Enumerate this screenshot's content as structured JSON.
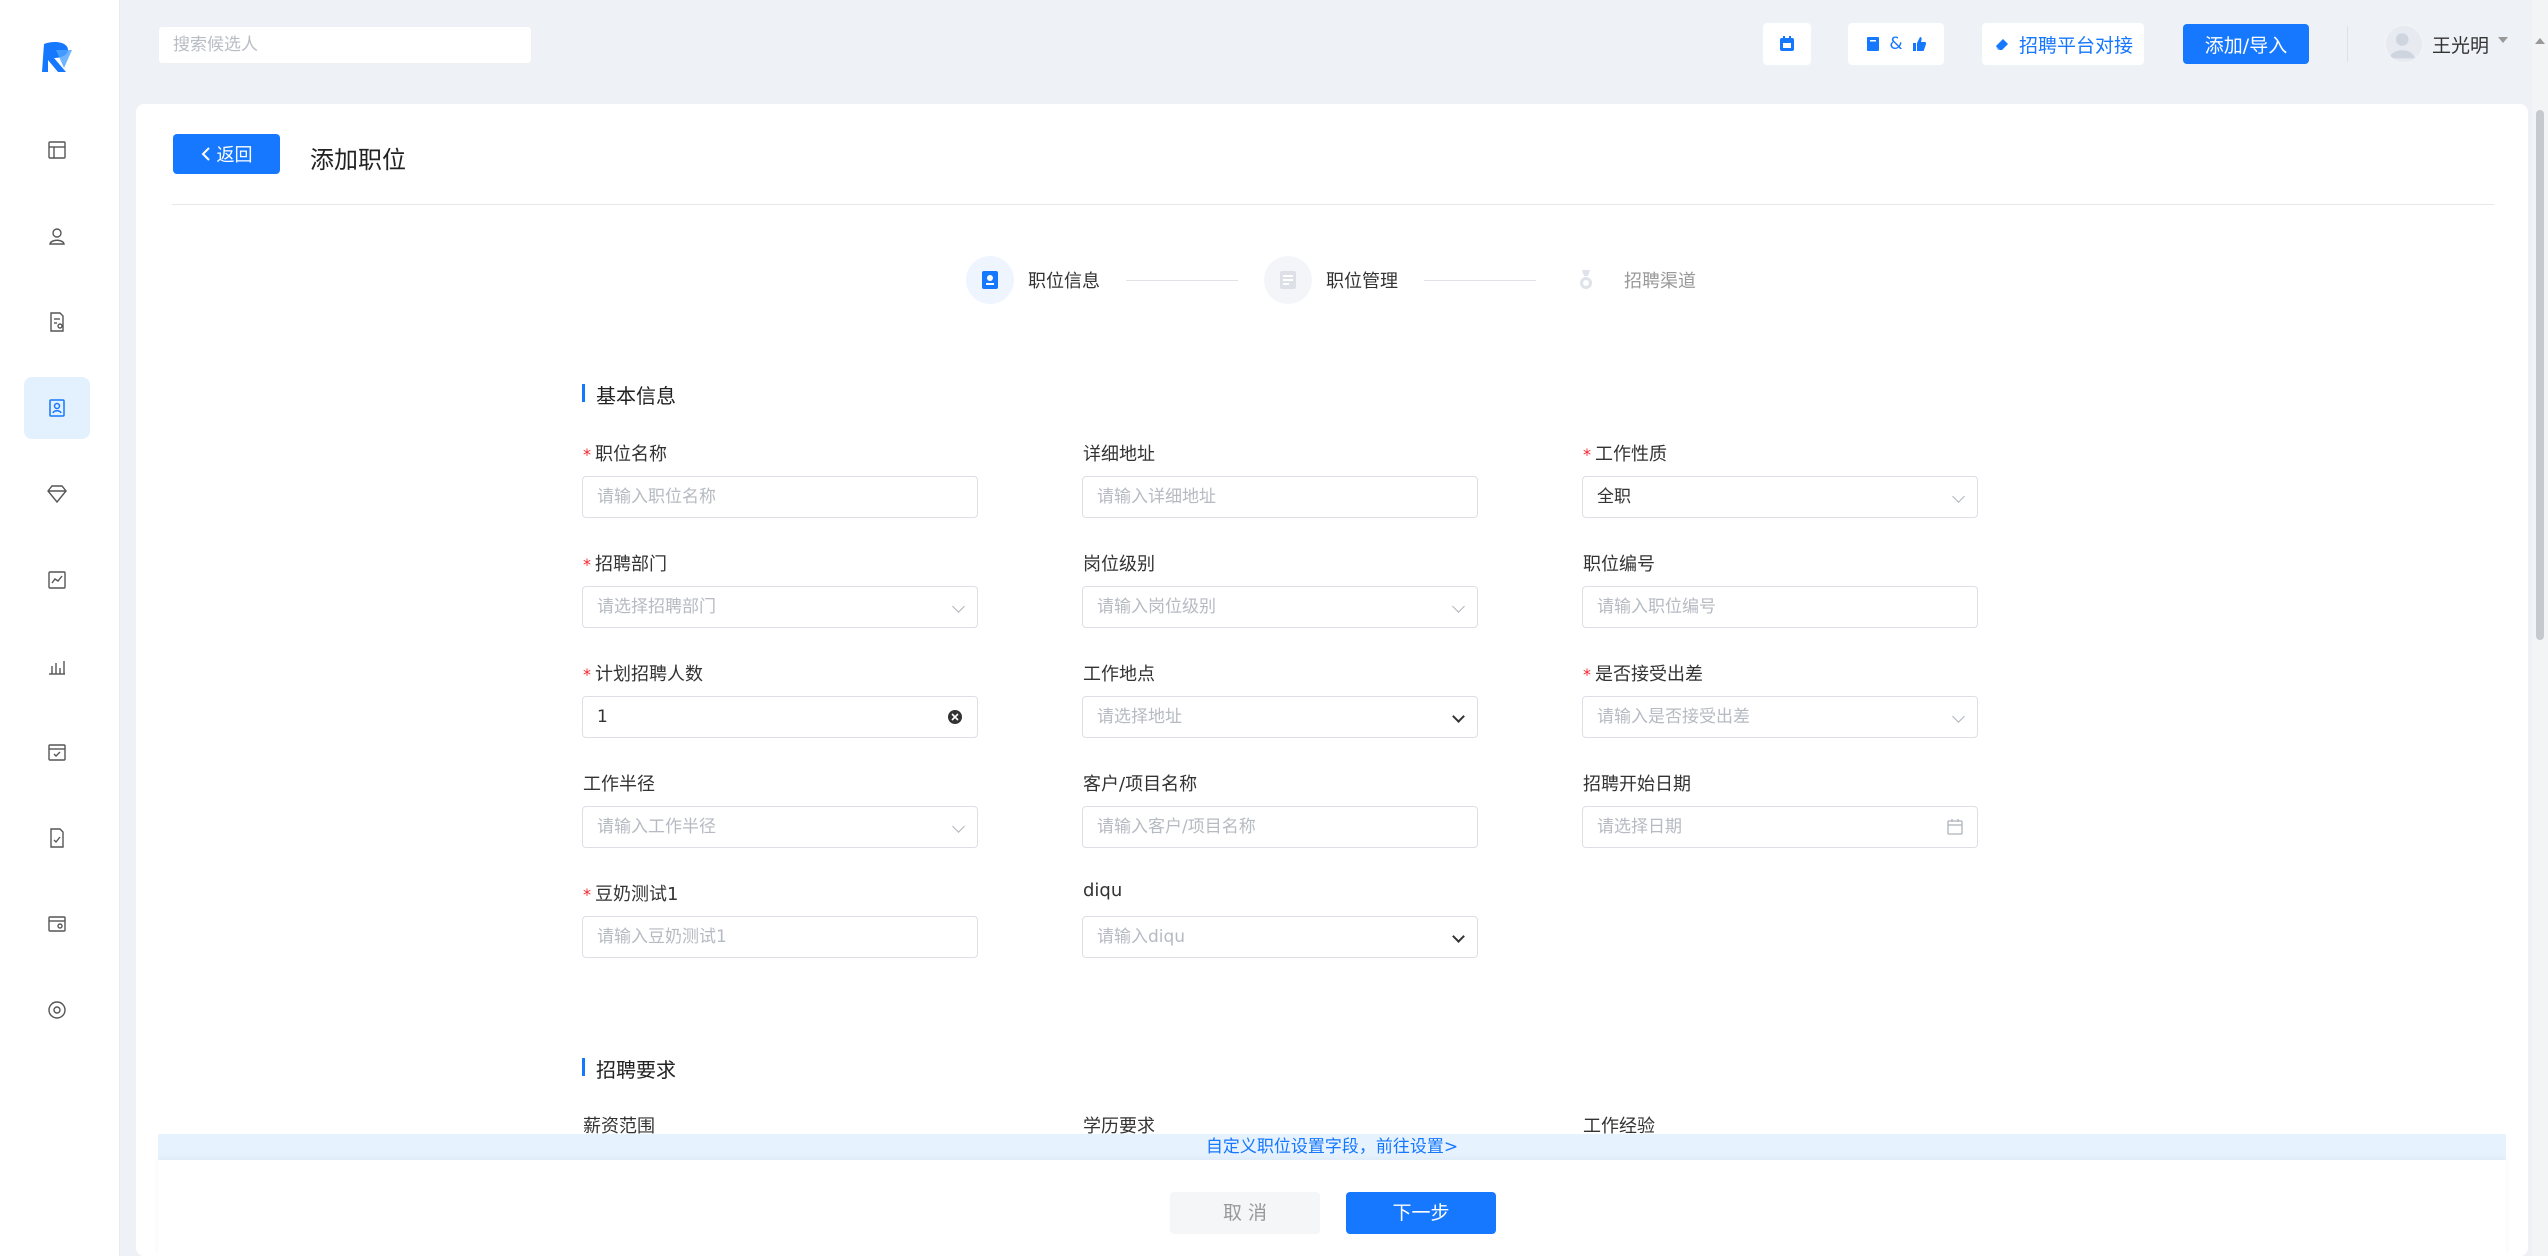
{
  "sidebar": {
    "items": [
      {
        "icon": "layout-icon"
      },
      {
        "icon": "user-icon"
      },
      {
        "icon": "resume-icon"
      },
      {
        "icon": "job-icon",
        "active": true
      },
      {
        "icon": "diamond-icon"
      },
      {
        "icon": "chart-icon"
      },
      {
        "icon": "bar-chart-icon"
      },
      {
        "icon": "calendar-check-icon"
      },
      {
        "icon": "document-icon"
      },
      {
        "icon": "folder-icon"
      },
      {
        "icon": "settings-icon"
      }
    ]
  },
  "topbar": {
    "search_placeholder": "搜索候选人",
    "combo_symbol": "&",
    "platform_label": "招聘平台对接",
    "add_import_label": "添加/导入",
    "user_name": "王光明"
  },
  "page": {
    "back_label": "返回",
    "title": "添加职位"
  },
  "steps": [
    {
      "label": "职位信息",
      "active": true
    },
    {
      "label": "职位管理",
      "active": false
    },
    {
      "label": "招聘渠道",
      "active": false
    }
  ],
  "basic": {
    "title": "基本信息",
    "fields": [
      {
        "label": "职位名称",
        "required": true,
        "placeholder": "请输入职位名称"
      },
      {
        "label": "详细地址",
        "required": false,
        "placeholder": "请输入详细地址"
      },
      {
        "label": "工作性质",
        "required": true,
        "value": "全职"
      },
      {
        "label": "招聘部门",
        "required": true,
        "placeholder": "请选择招聘部门"
      },
      {
        "label": "岗位级别",
        "required": false,
        "placeholder": "请输入岗位级别"
      },
      {
        "label": "职位编号",
        "required": false,
        "placeholder": "请输入职位编号"
      },
      {
        "label": "计划招聘人数",
        "required": true,
        "value": "1"
      },
      {
        "label": "工作地点",
        "required": false,
        "placeholder": "请选择地址"
      },
      {
        "label": "是否接受出差",
        "required": true,
        "placeholder": "请输入是否接受出差"
      },
      {
        "label": "工作半径",
        "required": false,
        "placeholder": "请输入工作半径"
      },
      {
        "label": "客户/项目名称",
        "required": false,
        "placeholder": "请输入客户/项目名称"
      },
      {
        "label": "招聘开始日期",
        "required": false,
        "placeholder": "请选择日期"
      },
      {
        "label": "豆奶测试1",
        "required": true,
        "placeholder": "请输入豆奶测试1"
      },
      {
        "label": "diqu",
        "required": false,
        "placeholder": "请输入diqu"
      }
    ]
  },
  "requirements": {
    "title": "招聘要求",
    "labels": [
      "薪资范围",
      "学历要求",
      "工作经验"
    ]
  },
  "banner_text": "自定义职位设置字段，前往设置>",
  "footer": {
    "cancel_label": "取 消",
    "next_label": "下一步"
  },
  "colors": {
    "primary": "#1677ff",
    "required": "#f5222d",
    "active_nav_bg": "#e3f0fd"
  }
}
